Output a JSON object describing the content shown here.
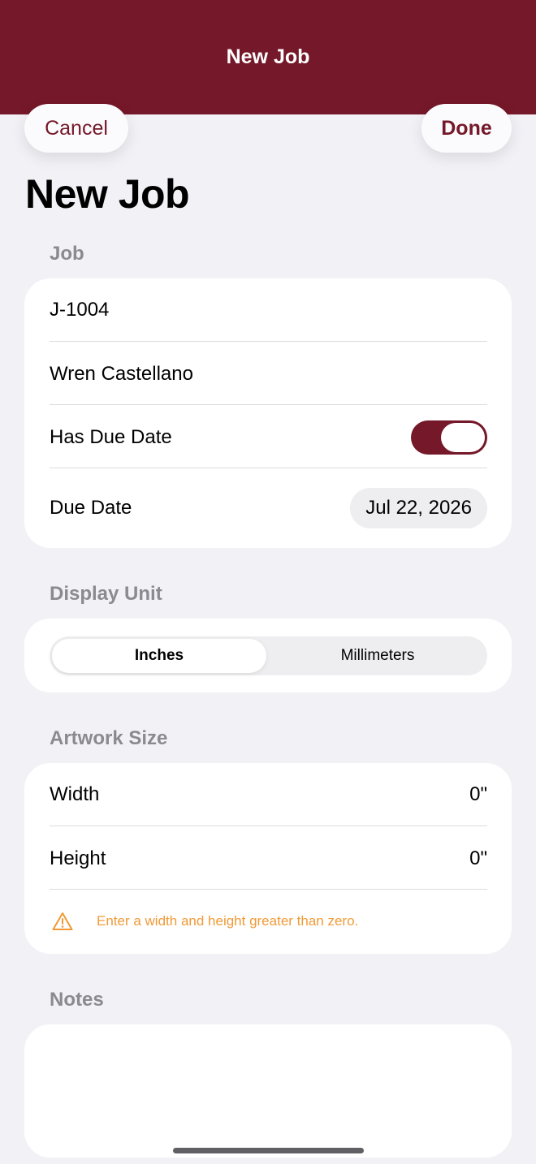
{
  "nav": {
    "title": "New Job",
    "cancel_label": "Cancel",
    "done_label": "Done"
  },
  "page_title": "New Job",
  "job_section": {
    "header": "Job",
    "job_number": "J-1004",
    "customer_name": "Wren Castellano",
    "has_due_date_label": "Has Due Date",
    "has_due_date": true,
    "due_date_label": "Due Date",
    "due_date_value": "Jul 22, 2026"
  },
  "display_unit_section": {
    "header": "Display Unit",
    "options": [
      "Inches",
      "Millimeters"
    ],
    "selected": "Inches"
  },
  "artwork_section": {
    "header": "Artwork Size",
    "width_label": "Width",
    "width_value": "0\"",
    "height_label": "Height",
    "height_value": "0\"",
    "warning_icon": "warning-triangle-icon",
    "warning_text": "Enter a width and height greater than zero."
  },
  "notes_section": {
    "header": "Notes",
    "value": ""
  },
  "colors": {
    "accent": "#751829",
    "warning": "#f09a37",
    "background": "#f2f1f6"
  }
}
